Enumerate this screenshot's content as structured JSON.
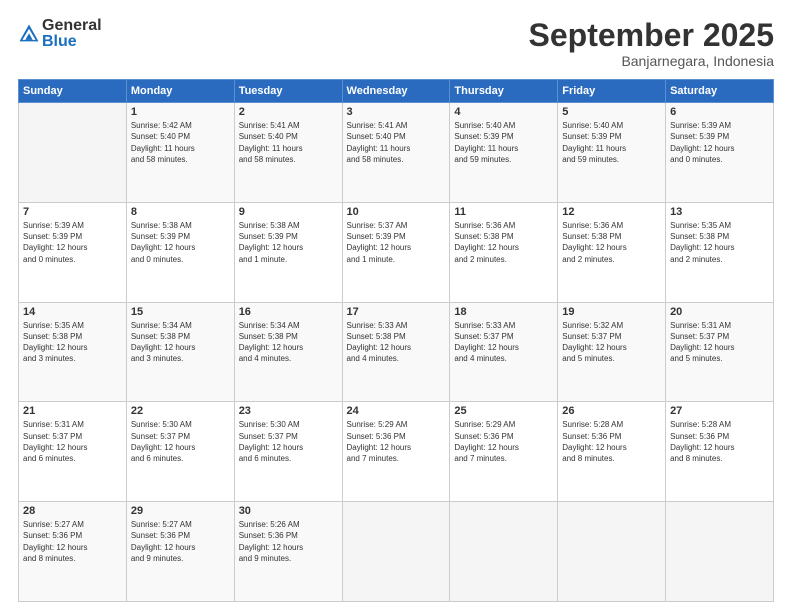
{
  "header": {
    "logo": {
      "general": "General",
      "blue": "Blue"
    },
    "title": "September 2025",
    "subtitle": "Banjarnegara, Indonesia"
  },
  "calendar": {
    "weekdays": [
      "Sunday",
      "Monday",
      "Tuesday",
      "Wednesday",
      "Thursday",
      "Friday",
      "Saturday"
    ],
    "weeks": [
      [
        {
          "day": "",
          "info": ""
        },
        {
          "day": "1",
          "info": "Sunrise: 5:42 AM\nSunset: 5:40 PM\nDaylight: 11 hours\nand 58 minutes."
        },
        {
          "day": "2",
          "info": "Sunrise: 5:41 AM\nSunset: 5:40 PM\nDaylight: 11 hours\nand 58 minutes."
        },
        {
          "day": "3",
          "info": "Sunrise: 5:41 AM\nSunset: 5:40 PM\nDaylight: 11 hours\nand 58 minutes."
        },
        {
          "day": "4",
          "info": "Sunrise: 5:40 AM\nSunset: 5:39 PM\nDaylight: 11 hours\nand 59 minutes."
        },
        {
          "day": "5",
          "info": "Sunrise: 5:40 AM\nSunset: 5:39 PM\nDaylight: 11 hours\nand 59 minutes."
        },
        {
          "day": "6",
          "info": "Sunrise: 5:39 AM\nSunset: 5:39 PM\nDaylight: 12 hours\nand 0 minutes."
        }
      ],
      [
        {
          "day": "7",
          "info": "Sunrise: 5:39 AM\nSunset: 5:39 PM\nDaylight: 12 hours\nand 0 minutes."
        },
        {
          "day": "8",
          "info": "Sunrise: 5:38 AM\nSunset: 5:39 PM\nDaylight: 12 hours\nand 0 minutes."
        },
        {
          "day": "9",
          "info": "Sunrise: 5:38 AM\nSunset: 5:39 PM\nDaylight: 12 hours\nand 1 minute."
        },
        {
          "day": "10",
          "info": "Sunrise: 5:37 AM\nSunset: 5:39 PM\nDaylight: 12 hours\nand 1 minute."
        },
        {
          "day": "11",
          "info": "Sunrise: 5:36 AM\nSunset: 5:38 PM\nDaylight: 12 hours\nand 2 minutes."
        },
        {
          "day": "12",
          "info": "Sunrise: 5:36 AM\nSunset: 5:38 PM\nDaylight: 12 hours\nand 2 minutes."
        },
        {
          "day": "13",
          "info": "Sunrise: 5:35 AM\nSunset: 5:38 PM\nDaylight: 12 hours\nand 2 minutes."
        }
      ],
      [
        {
          "day": "14",
          "info": "Sunrise: 5:35 AM\nSunset: 5:38 PM\nDaylight: 12 hours\nand 3 minutes."
        },
        {
          "day": "15",
          "info": "Sunrise: 5:34 AM\nSunset: 5:38 PM\nDaylight: 12 hours\nand 3 minutes."
        },
        {
          "day": "16",
          "info": "Sunrise: 5:34 AM\nSunset: 5:38 PM\nDaylight: 12 hours\nand 4 minutes."
        },
        {
          "day": "17",
          "info": "Sunrise: 5:33 AM\nSunset: 5:38 PM\nDaylight: 12 hours\nand 4 minutes."
        },
        {
          "day": "18",
          "info": "Sunrise: 5:33 AM\nSunset: 5:37 PM\nDaylight: 12 hours\nand 4 minutes."
        },
        {
          "day": "19",
          "info": "Sunrise: 5:32 AM\nSunset: 5:37 PM\nDaylight: 12 hours\nand 5 minutes."
        },
        {
          "day": "20",
          "info": "Sunrise: 5:31 AM\nSunset: 5:37 PM\nDaylight: 12 hours\nand 5 minutes."
        }
      ],
      [
        {
          "day": "21",
          "info": "Sunrise: 5:31 AM\nSunset: 5:37 PM\nDaylight: 12 hours\nand 6 minutes."
        },
        {
          "day": "22",
          "info": "Sunrise: 5:30 AM\nSunset: 5:37 PM\nDaylight: 12 hours\nand 6 minutes."
        },
        {
          "day": "23",
          "info": "Sunrise: 5:30 AM\nSunset: 5:37 PM\nDaylight: 12 hours\nand 6 minutes."
        },
        {
          "day": "24",
          "info": "Sunrise: 5:29 AM\nSunset: 5:36 PM\nDaylight: 12 hours\nand 7 minutes."
        },
        {
          "day": "25",
          "info": "Sunrise: 5:29 AM\nSunset: 5:36 PM\nDaylight: 12 hours\nand 7 minutes."
        },
        {
          "day": "26",
          "info": "Sunrise: 5:28 AM\nSunset: 5:36 PM\nDaylight: 12 hours\nand 8 minutes."
        },
        {
          "day": "27",
          "info": "Sunrise: 5:28 AM\nSunset: 5:36 PM\nDaylight: 12 hours\nand 8 minutes."
        }
      ],
      [
        {
          "day": "28",
          "info": "Sunrise: 5:27 AM\nSunset: 5:36 PM\nDaylight: 12 hours\nand 8 minutes."
        },
        {
          "day": "29",
          "info": "Sunrise: 5:27 AM\nSunset: 5:36 PM\nDaylight: 12 hours\nand 9 minutes."
        },
        {
          "day": "30",
          "info": "Sunrise: 5:26 AM\nSunset: 5:36 PM\nDaylight: 12 hours\nand 9 minutes."
        },
        {
          "day": "",
          "info": ""
        },
        {
          "day": "",
          "info": ""
        },
        {
          "day": "",
          "info": ""
        },
        {
          "day": "",
          "info": ""
        }
      ]
    ]
  }
}
